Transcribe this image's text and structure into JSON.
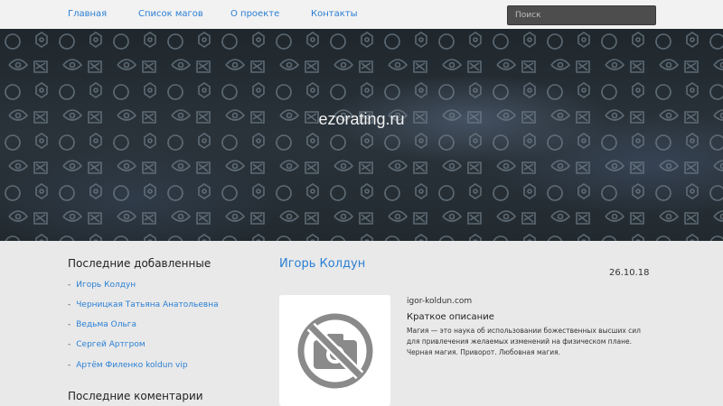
{
  "nav": {
    "items": [
      {
        "label": "Главная"
      },
      {
        "label": "Список магов"
      },
      {
        "label": "О проекте"
      },
      {
        "label": "Контакты"
      }
    ],
    "search_placeholder": "Поиск"
  },
  "hero": {
    "title": "ezorating.ru"
  },
  "sidebar": {
    "recent_title": "Последние добавленные",
    "recent_items": [
      {
        "label": "Игорь Колдун"
      },
      {
        "label": "Черницкая Татьяна Анатольевна"
      },
      {
        "label": "Ведьма Ольга"
      },
      {
        "label": "Сергей Артгром"
      },
      {
        "label": "Артём Филенко koldun vip"
      }
    ],
    "comments_title": "Последние коментарии"
  },
  "post": {
    "title": "Игорь Колдун",
    "date": "26.10.18",
    "site": "igor-koldun.com",
    "description_heading": "Краткое описание",
    "description": "Магия — это наука об использовании божественных высших сил для привлечения желаемых изменений на физическом плане. Черная магия. Приворот. Любовная магия."
  },
  "colors": {
    "link": "#2a7fd4",
    "page_background": "#e9e9e9",
    "nav_background": "#f2f2f2",
    "search_background": "#4d4d4d",
    "hero_background": "#262e34"
  },
  "icons": {
    "thumbnail": "no-photo-icon"
  }
}
